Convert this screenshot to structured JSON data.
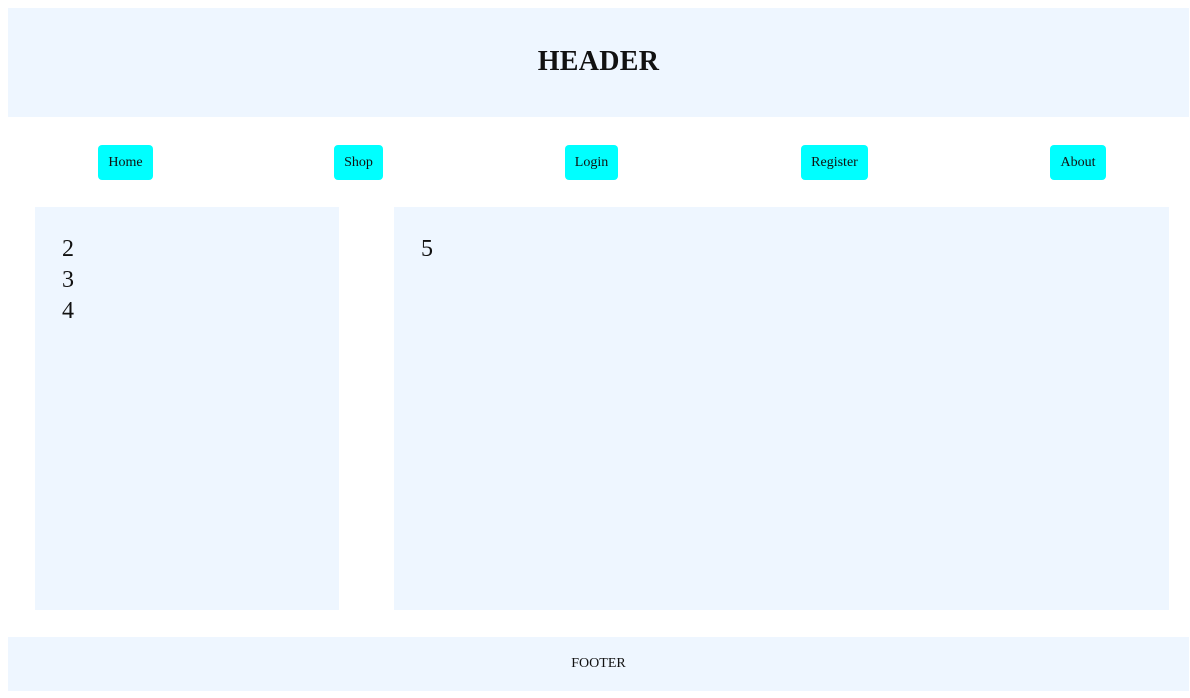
{
  "header": {
    "title": "HEADER"
  },
  "nav": {
    "items": [
      {
        "label": "Home"
      },
      {
        "label": "Shop"
      },
      {
        "label": "Login"
      },
      {
        "label": "Register"
      },
      {
        "label": "About"
      }
    ]
  },
  "sidebar": {
    "items": [
      "2",
      "3",
      "4"
    ]
  },
  "main": {
    "content": "5"
  },
  "footer": {
    "text": "FOOTER"
  },
  "colors": {
    "panel_background": "#eef6ff",
    "nav_button": "#00ffff"
  }
}
